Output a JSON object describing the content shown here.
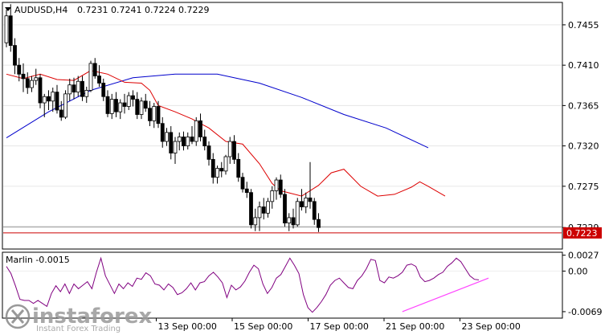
{
  "header": {
    "symbol_tf": "AUDUSD,H4",
    "ohlc": "0.7231 0.7241 0.7224 0.7229"
  },
  "indicator": {
    "label": "Marlin -0.0015"
  },
  "price_axis": {
    "ticks": [
      {
        "label": "0.7455",
        "value": 0.7455
      },
      {
        "label": "0.7410",
        "value": 0.741
      },
      {
        "label": "0.7365",
        "value": 0.7365
      },
      {
        "label": "0.7320",
        "value": 0.732
      },
      {
        "label": "0.7275",
        "value": 0.7275
      },
      {
        "label": "0.7229",
        "value": 0.7229
      }
    ],
    "current_price_label": "0.7223"
  },
  "osc_axis": {
    "ticks": [
      {
        "label": "0.0027",
        "value": 0.0027
      },
      {
        "label": "0.00",
        "value": 0.0
      },
      {
        "label": "-0.0069",
        "value": -0.0069
      }
    ]
  },
  "time_axis": {
    "ticks": [
      {
        "label": "13 Sep 00:00",
        "bar": 38
      },
      {
        "label": "15 Sep 00:00",
        "bar": 56
      },
      {
        "label": "17 Sep 00:00",
        "bar": 74
      },
      {
        "label": "21 Sep 00:00",
        "bar": 92
      },
      {
        "label": "23 Sep 00:00",
        "bar": 110
      }
    ]
  },
  "watermark": {
    "brand": "instaforex",
    "tagline": "Instant Forex Trading"
  },
  "colors": {
    "bull": "#ffffff",
    "bear": "#000000",
    "ma_slow": "#0000cc",
    "ma_fast": "#dd0000",
    "oscillator": "#800080",
    "trendline": "#ff44ff",
    "price_line": "#cc0000"
  },
  "chart_data": [
    {
      "type": "candlestick",
      "series_note": "AUDUSD H4",
      "ylim": [
        0.7205,
        0.748
      ],
      "candles": [
        [
          0.7435,
          0.7472,
          0.743,
          0.7465
        ],
        [
          0.7465,
          0.7478,
          0.7425,
          0.7432
        ],
        [
          0.7432,
          0.744,
          0.74,
          0.741
        ],
        [
          0.741,
          0.7418,
          0.7392,
          0.74
        ],
        [
          0.74,
          0.7412,
          0.738,
          0.7395
        ],
        [
          0.7395,
          0.7402,
          0.7378,
          0.7385
        ],
        [
          0.7385,
          0.7398,
          0.738,
          0.7393
        ],
        [
          0.7393,
          0.7406,
          0.7388,
          0.7396
        ],
        [
          0.7396,
          0.74,
          0.7362,
          0.7368
        ],
        [
          0.7368,
          0.7378,
          0.7352,
          0.7375
        ],
        [
          0.7375,
          0.7382,
          0.736,
          0.737
        ],
        [
          0.737,
          0.7385,
          0.7358,
          0.738
        ],
        [
          0.738,
          0.7388,
          0.7356,
          0.736
        ],
        [
          0.736,
          0.737,
          0.7348,
          0.7352
        ],
        [
          0.7352,
          0.7382,
          0.735,
          0.7378
        ],
        [
          0.7378,
          0.7395,
          0.737,
          0.7388
        ],
        [
          0.7388,
          0.7396,
          0.7372,
          0.738
        ],
        [
          0.738,
          0.7398,
          0.7375,
          0.7392
        ],
        [
          0.7392,
          0.7398,
          0.737,
          0.7375
        ],
        [
          0.7375,
          0.7386,
          0.7368,
          0.7382
        ],
        [
          0.7382,
          0.7415,
          0.738,
          0.7412
        ],
        [
          0.7412,
          0.7418,
          0.7395,
          0.7398
        ],
        [
          0.7398,
          0.741,
          0.7386,
          0.739
        ],
        [
          0.739,
          0.7395,
          0.737,
          0.7375
        ],
        [
          0.7375,
          0.7382,
          0.7352,
          0.7356
        ],
        [
          0.7356,
          0.7378,
          0.735,
          0.7372
        ],
        [
          0.7372,
          0.738,
          0.7352,
          0.7358
        ],
        [
          0.7358,
          0.7372,
          0.735,
          0.7368
        ],
        [
          0.7368,
          0.7378,
          0.7356,
          0.7364
        ],
        [
          0.7364,
          0.738,
          0.736,
          0.7376
        ],
        [
          0.7376,
          0.7382,
          0.7364,
          0.7372
        ],
        [
          0.7372,
          0.738,
          0.735,
          0.7355
        ],
        [
          0.7355,
          0.7374,
          0.735,
          0.737
        ],
        [
          0.737,
          0.7378,
          0.7358,
          0.7362
        ],
        [
          0.7362,
          0.737,
          0.7342,
          0.7348
        ],
        [
          0.7348,
          0.7368,
          0.734,
          0.7364
        ],
        [
          0.7364,
          0.737,
          0.734,
          0.7345
        ],
        [
          0.7345,
          0.7352,
          0.7318,
          0.7325
        ],
        [
          0.7325,
          0.734,
          0.732,
          0.7335
        ],
        [
          0.7335,
          0.7342,
          0.7305,
          0.7312
        ],
        [
          0.7312,
          0.733,
          0.73,
          0.7325
        ],
        [
          0.7325,
          0.7335,
          0.7315,
          0.733
        ],
        [
          0.733,
          0.7336,
          0.7315,
          0.732
        ],
        [
          0.732,
          0.7335,
          0.7316,
          0.733
        ],
        [
          0.733,
          0.7342,
          0.7322,
          0.7325
        ],
        [
          0.7325,
          0.7352,
          0.732,
          0.7348
        ],
        [
          0.7348,
          0.7356,
          0.7325,
          0.733
        ],
        [
          0.733,
          0.7338,
          0.7315,
          0.732
        ],
        [
          0.732,
          0.7325,
          0.7298,
          0.7305
        ],
        [
          0.7305,
          0.7312,
          0.7278,
          0.7285
        ],
        [
          0.7285,
          0.7298,
          0.7278,
          0.7295
        ],
        [
          0.7295,
          0.7302,
          0.7285,
          0.7292
        ],
        [
          0.7292,
          0.731,
          0.7288,
          0.7308
        ],
        [
          0.7308,
          0.733,
          0.73,
          0.7325
        ],
        [
          0.7325,
          0.7332,
          0.73,
          0.7305
        ],
        [
          0.7305,
          0.7312,
          0.728,
          0.7285
        ],
        [
          0.7285,
          0.729,
          0.7268,
          0.7272
        ],
        [
          0.7272,
          0.728,
          0.7262,
          0.7268
        ],
        [
          0.7268,
          0.7272,
          0.7228,
          0.7232
        ],
        [
          0.7232,
          0.725,
          0.7225,
          0.724
        ],
        [
          0.724,
          0.7258,
          0.7225,
          0.7252
        ],
        [
          0.7252,
          0.7262,
          0.7238,
          0.7245
        ],
        [
          0.7245,
          0.7262,
          0.724,
          0.7258
        ],
        [
          0.7258,
          0.7275,
          0.725,
          0.727
        ],
        [
          0.727,
          0.7285,
          0.726,
          0.7282
        ],
        [
          0.7282,
          0.7288,
          0.7262,
          0.7266
        ],
        [
          0.7266,
          0.7272,
          0.723,
          0.7234
        ],
        [
          0.7234,
          0.7245,
          0.7225,
          0.724
        ],
        [
          0.724,
          0.725,
          0.7228,
          0.7232
        ],
        [
          0.7232,
          0.7262,
          0.723,
          0.7258
        ],
        [
          0.7258,
          0.7272,
          0.7248,
          0.7252
        ],
        [
          0.7252,
          0.7268,
          0.7245,
          0.7262
        ],
        [
          0.7262,
          0.7302,
          0.725,
          0.7258
        ],
        [
          0.7258,
          0.7262,
          0.7232,
          0.7238
        ],
        [
          0.7238,
          0.7245,
          0.7224,
          0.7229
        ]
      ]
    },
    {
      "type": "line",
      "series_note": "moving averages",
      "series": [
        {
          "points": [
            [
              0,
              0.7329
            ],
            [
              10,
              0.7358
            ],
            [
              20,
              0.7382
            ],
            [
              30,
              0.7396
            ],
            [
              40,
              0.74
            ],
            [
              50,
              0.74
            ],
            [
              60,
              0.739
            ],
            [
              70,
              0.7374
            ],
            [
              80,
              0.7355
            ],
            [
              90,
              0.734
            ],
            [
              100,
              0.7318
            ]
          ]
        },
        {
          "points": [
            [
              0,
              0.74
            ],
            [
              4,
              0.7395
            ],
            [
              8,
              0.74
            ],
            [
              12,
              0.7394
            ],
            [
              16,
              0.7393
            ],
            [
              20,
              0.7404
            ],
            [
              24,
              0.74
            ],
            [
              28,
              0.7391
            ],
            [
              32,
              0.739
            ],
            [
              34,
              0.7382
            ],
            [
              36,
              0.7365
            ],
            [
              40,
              0.7358
            ],
            [
              44,
              0.735
            ],
            [
              48,
              0.734
            ],
            [
              52,
              0.7325
            ],
            [
              56,
              0.7322
            ],
            [
              60,
              0.73
            ],
            [
              63,
              0.7278
            ],
            [
              65,
              0.727
            ],
            [
              70,
              0.7264
            ],
            [
              74,
              0.7276
            ],
            [
              77,
              0.729
            ],
            [
              80,
              0.7294
            ],
            [
              84,
              0.7275
            ],
            [
              88,
              0.7264
            ],
            [
              92,
              0.7266
            ],
            [
              96,
              0.7274
            ],
            [
              98,
              0.728
            ],
            [
              100,
              0.7275
            ],
            [
              104,
              0.7264
            ]
          ]
        }
      ]
    },
    {
      "type": "line",
      "series_note": "Marlin oscillator",
      "ylim": [
        -0.008,
        0.0032
      ],
      "values": [
        0.0008,
        -0.0004,
        -0.0025,
        -0.0048,
        -0.005,
        -0.005,
        -0.0055,
        -0.005,
        -0.0055,
        -0.006,
        -0.0038,
        -0.0025,
        -0.0035,
        -0.0022,
        -0.0038,
        -0.0022,
        -0.003,
        -0.0024,
        -0.0018,
        -0.003,
        -0.0002,
        0.0022,
        -0.0008,
        -0.0023,
        -0.0038,
        -0.0022,
        -0.003,
        -0.002,
        -0.0026,
        -0.0012,
        -0.0014,
        -0.0003,
        -0.0008,
        -0.0022,
        -0.0024,
        -0.0032,
        -0.0022,
        -0.0028,
        -0.004,
        -0.0037,
        -0.003,
        -0.002,
        -0.0032,
        -0.002,
        -0.0018,
        -0.0008,
        -0.0002,
        -0.001,
        -0.002,
        -0.0045,
        -0.0024,
        -0.0032,
        -0.0027,
        -0.0017,
        -0.0002,
        0.001,
        0.0004,
        -0.0022,
        -0.0038,
        -0.0028,
        -0.0012,
        -0.0006,
        0.0008,
        0.0022,
        0.001,
        -0.0004,
        -0.004,
        -0.0062,
        -0.007,
        -0.0062,
        -0.0052,
        -0.004,
        -0.0024,
        -0.0016,
        -0.0012,
        -0.002,
        -0.0028,
        -0.003,
        -0.0016,
        -0.0008,
        0.0004,
        0.002,
        0.0018,
        -0.0016,
        -0.002,
        -0.001,
        -0.0012,
        -0.0008,
        -0.0002,
        0.001,
        0.0012,
        0.0008,
        -0.001,
        -0.0018,
        -0.0016,
        -0.0012,
        -0.0006,
        -0.0002,
        0.0008,
        0.0014,
        0.0022,
        0.0016,
        0.0004,
        -0.0008,
        -0.0014,
        -0.0015
      ],
      "trendline": [
        [
          88,
          -0.0069
        ],
        [
          120,
          -0.0012
        ]
      ]
    }
  ]
}
